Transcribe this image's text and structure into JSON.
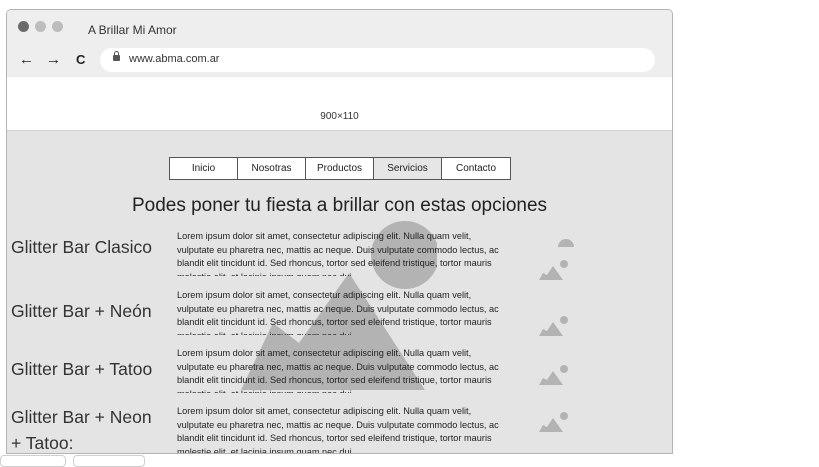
{
  "browser": {
    "tab_title": "A Brillar Mi Amor",
    "url": "www.abma.com.ar",
    "back_icon": "←",
    "forward_icon": "→",
    "reload_icon": "C"
  },
  "hero": {
    "placeholder_text": "900×110"
  },
  "menu": {
    "items": [
      {
        "label": "Inicio"
      },
      {
        "label": "Nosotras"
      },
      {
        "label": "Productos"
      },
      {
        "label": "Servicios",
        "active": true
      },
      {
        "label": "Contacto"
      }
    ]
  },
  "main": {
    "heading": "Podes poner tu fiesta a brillar con estas opciones",
    "options": [
      {
        "title": "Glitter Bar Clasico",
        "description": "Lorem ipsum dolor sit amet, consectetur adipiscing elit. Nulla quam velit, vulputate eu pharetra nec, mattis ac neque. Duis vulputate commodo lectus, ac blandit elit tincidunt id. Sed rhoncus, tortor sed eleifend tristique, tortor mauris molestie elit, et lacinia ipsum quam nec dui."
      },
      {
        "title": "Glitter Bar + Neón",
        "description": "Lorem ipsum dolor sit amet, consectetur adipiscing elit. Nulla quam velit, vulputate eu pharetra nec, mattis ac neque. Duis vulputate commodo lectus, ac blandit elit tincidunt id. Sed rhoncus, tortor sed eleifend tristique, tortor mauris molestie elit, et lacinia ipsum quam nec dui."
      },
      {
        "title": "Glitter Bar + Tatoo",
        "description": "Lorem ipsum dolor sit amet, consectetur adipiscing elit. Nulla quam velit, vulputate eu pharetra nec, mattis ac neque. Duis vulputate commodo lectus, ac blandit elit tincidunt id. Sed rhoncus, tortor sed eleifend tristique, tortor mauris molestie elit, et lacinia ipsum quam nec dui."
      },
      {
        "title": "Glitter Bar + Neon + Tatoo:",
        "description": "Lorem ipsum dolor sit amet, consectetur adipiscing elit. Nulla quam velit, vulputate eu pharetra nec, mattis ac neque. Duis vulputate commodo lectus, ac blandit elit tincidunt id. Sed rhoncus, tortor sed eleifend tristique, tortor mauris molestie elit, et lacinia ipsum quam nec dui."
      }
    ]
  },
  "colors": {
    "page_background": "#e4e4e4",
    "placeholder_gray": "#b3b3b3"
  }
}
